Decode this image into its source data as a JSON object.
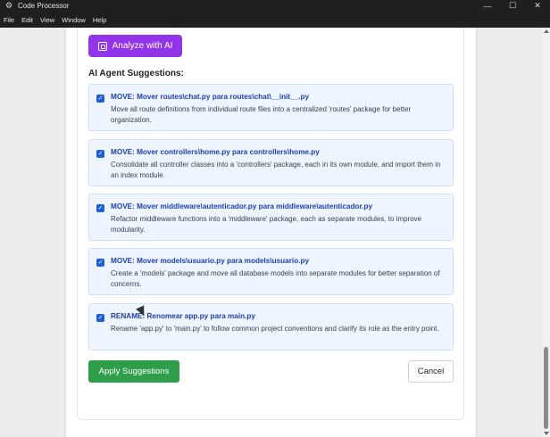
{
  "window": {
    "title": "Code Processor",
    "controls": {
      "minimize": "—",
      "maximize": "☐",
      "close": "✕"
    }
  },
  "menubar": {
    "items": [
      "File",
      "Edit",
      "View",
      "Window",
      "Help"
    ]
  },
  "analyze_button": {
    "label": "Analyze with AI"
  },
  "section_title": "AI Agent Suggestions:",
  "suggestions": [
    {
      "checked": true,
      "title": "MOVE: Mover routes\\chat.py para routes\\chat\\__init__.py",
      "description": "Move all route definitions from individual route files into a centralized 'routes' package for better organization."
    },
    {
      "checked": true,
      "title": "MOVE: Mover controllers\\home.py para controllers\\home.py",
      "description": "Consolidate all controller classes into a 'controllers' package, each in its own module, and import them in an index module."
    },
    {
      "checked": true,
      "title": "MOVE: Mover middleware\\autenticador.py para middleware\\autenticador.py",
      "description": "Refactor middleware functions into a 'middleware' package, each as separate modules, to improve modularity."
    },
    {
      "checked": true,
      "title": "MOVE: Mover models\\usuario.py para models\\usuario.py",
      "description": "Create a 'models' package and move all database models into separate modules for better separation of concerns."
    },
    {
      "checked": true,
      "title": "RENAME: Renomear app.py para main.py",
      "description": "Rename 'app.py' to 'main.py' to follow common project conventions and clarify its role as the entry point."
    }
  ],
  "footer": {
    "apply_label": "Apply Suggestions",
    "cancel_label": "Cancel"
  },
  "colors": {
    "accent_purple": "#9333ea",
    "apply_green": "#2f9e4a",
    "suggestion_bg": "#eef5ff",
    "suggestion_title": "#1e40af"
  }
}
